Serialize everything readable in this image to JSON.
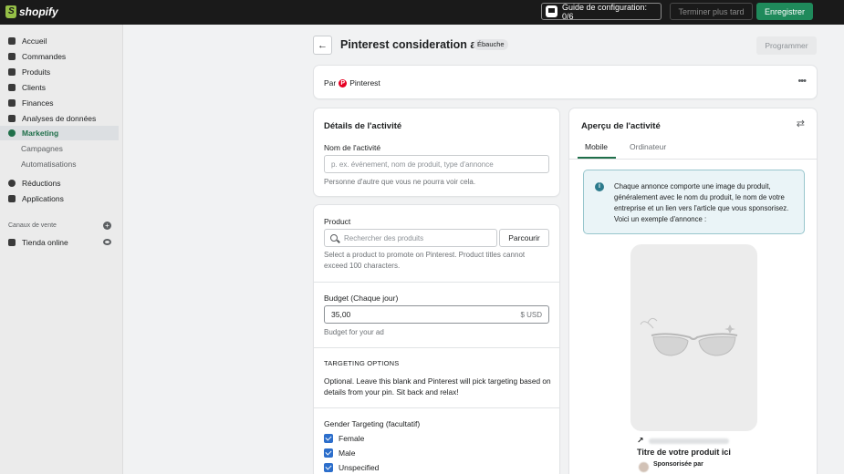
{
  "topbar": {
    "brand": "shopify",
    "setup_guide": "Guide de configuration: 0/6",
    "finish_later": "Terminer plus tard",
    "save": "Enregistrer"
  },
  "sidebar": {
    "items": [
      {
        "label": "Accueil",
        "icon": "home-icon"
      },
      {
        "label": "Commandes",
        "icon": "orders-icon"
      },
      {
        "label": "Produits",
        "icon": "tag-icon"
      },
      {
        "label": "Clients",
        "icon": "person-icon"
      },
      {
        "label": "Finances",
        "icon": "bank-icon"
      },
      {
        "label": "Analyses de données",
        "icon": "chart-icon"
      },
      {
        "label": "Marketing",
        "icon": "target-icon"
      }
    ],
    "marketing_sub": [
      "Campagnes",
      "Automatisations"
    ],
    "items2": [
      {
        "label": "Réductions",
        "icon": "discount-icon"
      },
      {
        "label": "Applications",
        "icon": "apps-icon"
      }
    ],
    "sales_channels_label": "Canaux de vente",
    "online_store": "Tienda online"
  },
  "page": {
    "title": "Pinterest consideration ad",
    "status_badge": "Ébauche",
    "schedule_button": "Programmer"
  },
  "by_card": {
    "prefix": "Par",
    "platform": "Pinterest",
    "pin_glyph": "P",
    "more": "•••"
  },
  "details": {
    "title": "Détails de l'activité",
    "name_label": "Nom de l'activité",
    "name_placeholder": "p. ex. événement, nom de produit, type d'annonce",
    "name_help": "Personne d'autre que vous ne pourra voir cela."
  },
  "product": {
    "label": "Product",
    "search_placeholder": "Rechercher des produits",
    "browse_button": "Parcourir",
    "help": "Select a product to promote on Pinterest. Product titles cannot exceed 100 characters.",
    "budget_label": "Budget (Chaque jour)",
    "budget_value": "35,00",
    "budget_suffix": "$ USD",
    "budget_help": "Budget for your ad",
    "targeting_heading": "TARGETING OPTIONS",
    "targeting_text": "Optional. Leave this blank and Pinterest will pick targeting based on details from your pin. Sit back and relax!",
    "gender_label": "Gender Targeting (facultatif)",
    "gender_options": [
      {
        "label": "Female",
        "checked": true
      },
      {
        "label": "Male",
        "checked": true
      },
      {
        "label": "Unspecified",
        "checked": true
      }
    ]
  },
  "preview": {
    "title": "Aperçu de l'activité",
    "tabs": [
      "Mobile",
      "Ordinateur"
    ],
    "active_tab": "Mobile",
    "info_glyph": "i",
    "info_text": "Chaque annonce comporte une image du produit, généralement avec le nom du produit, le nom de votre entreprise et un lien vers l'article que vous sponsorisez. Voici un exemple d'annonce :",
    "product_title": "Titre de votre produit ici",
    "sponsored_by": "Sponsorisée par"
  },
  "colors": {
    "accent": "#1f6f4a",
    "save_button": "#1f8a5b",
    "checkbox": "#2c6ecb",
    "pinterest": "#e60023"
  }
}
